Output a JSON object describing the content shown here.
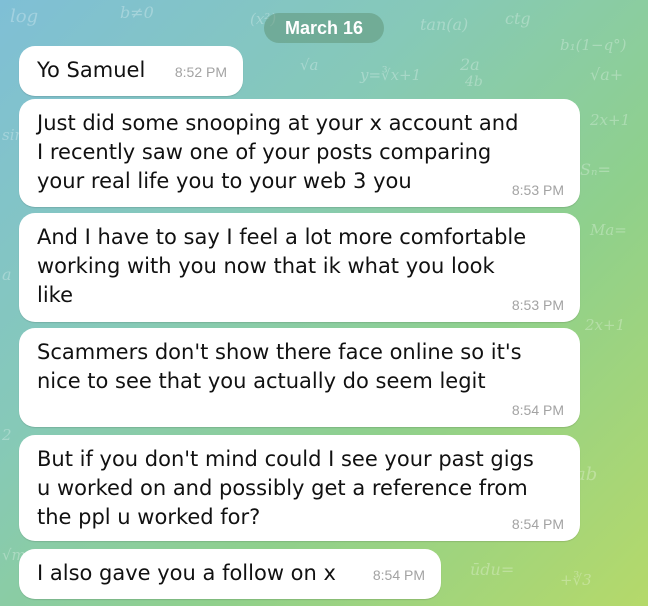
{
  "chat": {
    "date_label": "March 16",
    "messages": [
      {
        "text": "Yo Samuel",
        "time": "8:52 PM"
      },
      {
        "text": "Just did some snooping at your x account and\nI recently saw one of your posts comparing\nyour real life you to your web 3 you",
        "time": "8:53 PM"
      },
      {
        "text": "And I have to say I feel a lot more comfortable\nworking with you now that ik what you look\nlike",
        "time": "8:53 PM"
      },
      {
        "text": "Scammers don't show there face online so it's\nnice to see that you actually do seem legit",
        "time": "8:54 PM"
      },
      {
        "text": "But if you don't mind could I see your past gigs\nu worked on and possibly get a reference from\nthe ppl u worked for?",
        "time": "8:54 PM"
      },
      {
        "text": "I also gave you a follow on x",
        "time": "8:54 PM"
      }
    ]
  },
  "colors": {
    "bubble": "#ffffff",
    "text": "#111111",
    "timestamp": "#a3a3a3",
    "date_pill_text": "#ffffff"
  }
}
